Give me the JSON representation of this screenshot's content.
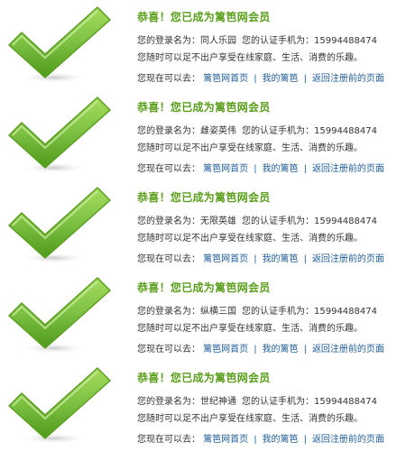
{
  "colors": {
    "title_green": "#5a9e1b",
    "link_blue": "#1f5c99",
    "check_green": "#7cc142"
  },
  "icons": {
    "check": "green-checkmark-icon"
  },
  "cards": [
    {
      "title": "恭喜！您已成为篱笆网会员",
      "login_label": "您的登录名为：",
      "login_value": "同人乐园",
      "phone_label": "您的认证手机为：",
      "phone_value": "15994488474",
      "description": "您随时可以足不出户享受在线家庭、生活、消费的乐趣。",
      "nav_label": "您现在可以去：",
      "links": [
        "篱笆网首页",
        "我的篱笆",
        "返回注册前的页面"
      ],
      "separator": "|"
    },
    {
      "title": "恭喜！您已成为篱笆网会员",
      "login_label": "您的登录名为：",
      "login_value": "雌姿英伟",
      "phone_label": "您的认证手机为：",
      "phone_value": "15994488474",
      "description": "您随时可以足不出户享受在线家庭、生活、消费的乐趣。",
      "nav_label": "您现在可以去：",
      "links": [
        "篱笆网首页",
        "我的篱笆",
        "返回注册前的页面"
      ],
      "separator": "|"
    },
    {
      "title": "恭喜！您已成为篱笆网会员",
      "login_label": "您的登录名为：",
      "login_value": "无限英雄",
      "phone_label": "您的认证手机为：",
      "phone_value": "15994488474",
      "description": "您随时可以足不出户享受在线家庭、生活、消费的乐趣。",
      "nav_label": "您现在可以去：",
      "links": [
        "篱笆网首页",
        "我的篱笆",
        "返回注册前的页面"
      ],
      "separator": "|"
    },
    {
      "title": "恭喜！您已成为篱笆网会员",
      "login_label": "您的登录名为：",
      "login_value": "纵横三国",
      "phone_label": "您的认证手机为：",
      "phone_value": "15994488474",
      "description": "您随时可以足不出户享受在线家庭、生活、消费的乐趣。",
      "nav_label": "您现在可以去：",
      "links": [
        "篱笆网首页",
        "我的篱笆",
        "返回注册前的页面"
      ],
      "separator": "|"
    },
    {
      "title": "恭喜！您已成为篱笆网会员",
      "login_label": "您的登录名为：",
      "login_value": "世纪神通",
      "phone_label": "您的认证手机为：",
      "phone_value": "15994488474",
      "description": "您随时可以足不出户享受在线家庭、生活、消费的乐趣。",
      "nav_label": "您现在可以去：",
      "links": [
        "篱笆网首页",
        "我的篱笆",
        "返回注册前的页面"
      ],
      "separator": "|"
    }
  ]
}
